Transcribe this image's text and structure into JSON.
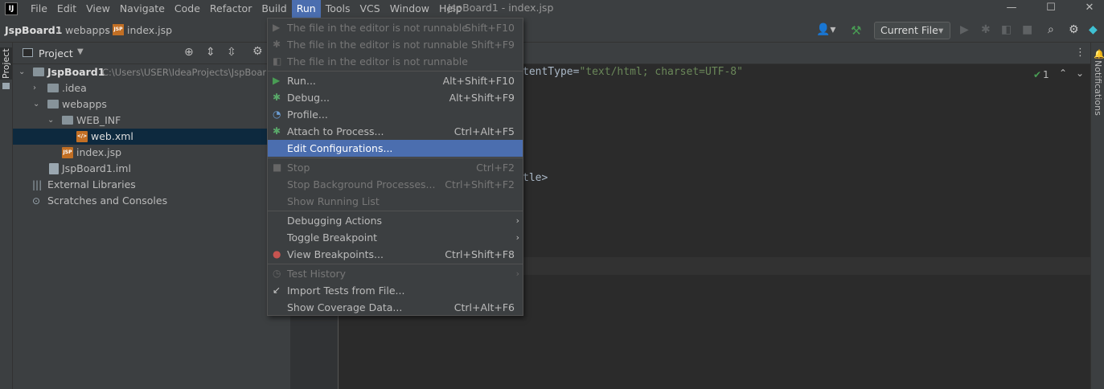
{
  "menubar": {
    "app_icon": "IJ",
    "items": [
      "File",
      "Edit",
      "View",
      "Navigate",
      "Code",
      "Refactor",
      "Build",
      "Run",
      "Tools",
      "VCS",
      "Window",
      "Help"
    ],
    "window_title": "JspBoard1 - index.jsp",
    "minimize": "—",
    "maximize": "☐",
    "close": "✕"
  },
  "breadcrumb": {
    "project": "JspBoard1",
    "folder": "webapps",
    "file": "index.jsp"
  },
  "toolbar": {
    "run_config": "Current File",
    "run_config_arrow": "▾"
  },
  "left_strip": {
    "project_tab": "Project"
  },
  "right_strip": {
    "notifications_tab": "Notifications"
  },
  "project_panel": {
    "title": "Project",
    "tree": [
      {
        "label": "JspBoard1",
        "path": "C:\\Users\\USER\\IdeaProjects\\JspBoar",
        "arrow": "⌄"
      },
      {
        "label": ".idea",
        "arrow": "›"
      },
      {
        "label": "webapps",
        "arrow": "⌄"
      },
      {
        "label": "WEB_INF",
        "arrow": "⌄"
      },
      {
        "label": "web.xml"
      },
      {
        "label": "index.jsp"
      },
      {
        "label": "JspBoard1.iml"
      },
      {
        "label": "External Libraries",
        "arrow": "›"
      },
      {
        "label": "Scratches and Consoles"
      }
    ]
  },
  "editor": {
    "line1_text": "tentType=",
    "line1_string": "\"text/html; charset=UTF-8\"",
    "line2_text": "tle>",
    "inspection_count": "1"
  },
  "run_menu": {
    "items": [
      {
        "label": "The file in the editor is not runnable",
        "shortcut": "Shift+F10",
        "disabled": true
      },
      {
        "label": "The file in the editor is not runnable",
        "shortcut": "Shift+F9",
        "disabled": true
      },
      {
        "label": "The file in the editor is not runnable",
        "shortcut": "",
        "disabled": true
      },
      {
        "label": "Run...",
        "shortcut": "Alt+Shift+F10"
      },
      {
        "label": "Debug...",
        "shortcut": "Alt+Shift+F9"
      },
      {
        "label": "Profile...",
        "shortcut": ""
      },
      {
        "label": "Attach to Process...",
        "shortcut": "Ctrl+Alt+F5"
      },
      {
        "label": "Edit Configurations...",
        "shortcut": "",
        "highlighted": true
      },
      {
        "label": "Stop",
        "shortcut": "Ctrl+F2",
        "disabled": true
      },
      {
        "label": "Stop Background Processes...",
        "shortcut": "Ctrl+Shift+F2",
        "disabled": true
      },
      {
        "label": "Show Running List",
        "shortcut": "",
        "disabled": true
      },
      {
        "label": "Debugging Actions",
        "shortcut": "",
        "submenu": true
      },
      {
        "label": "Toggle Breakpoint",
        "shortcut": "",
        "submenu": true
      },
      {
        "label": "View Breakpoints...",
        "shortcut": "Ctrl+Shift+F8"
      },
      {
        "label": "Test History",
        "shortcut": "",
        "disabled": true,
        "submenu": true
      },
      {
        "label": "Import Tests from File...",
        "shortcut": ""
      },
      {
        "label": "Show Coverage Data...",
        "shortcut": "Ctrl+Alt+F6"
      }
    ]
  },
  "colors": {
    "menu_highlight": "#4b6eaf",
    "selected_tree_row": "#0d293e",
    "run_green": "#499c54",
    "debug_green": "#59a869",
    "breakpoint_red": "#c75450"
  }
}
